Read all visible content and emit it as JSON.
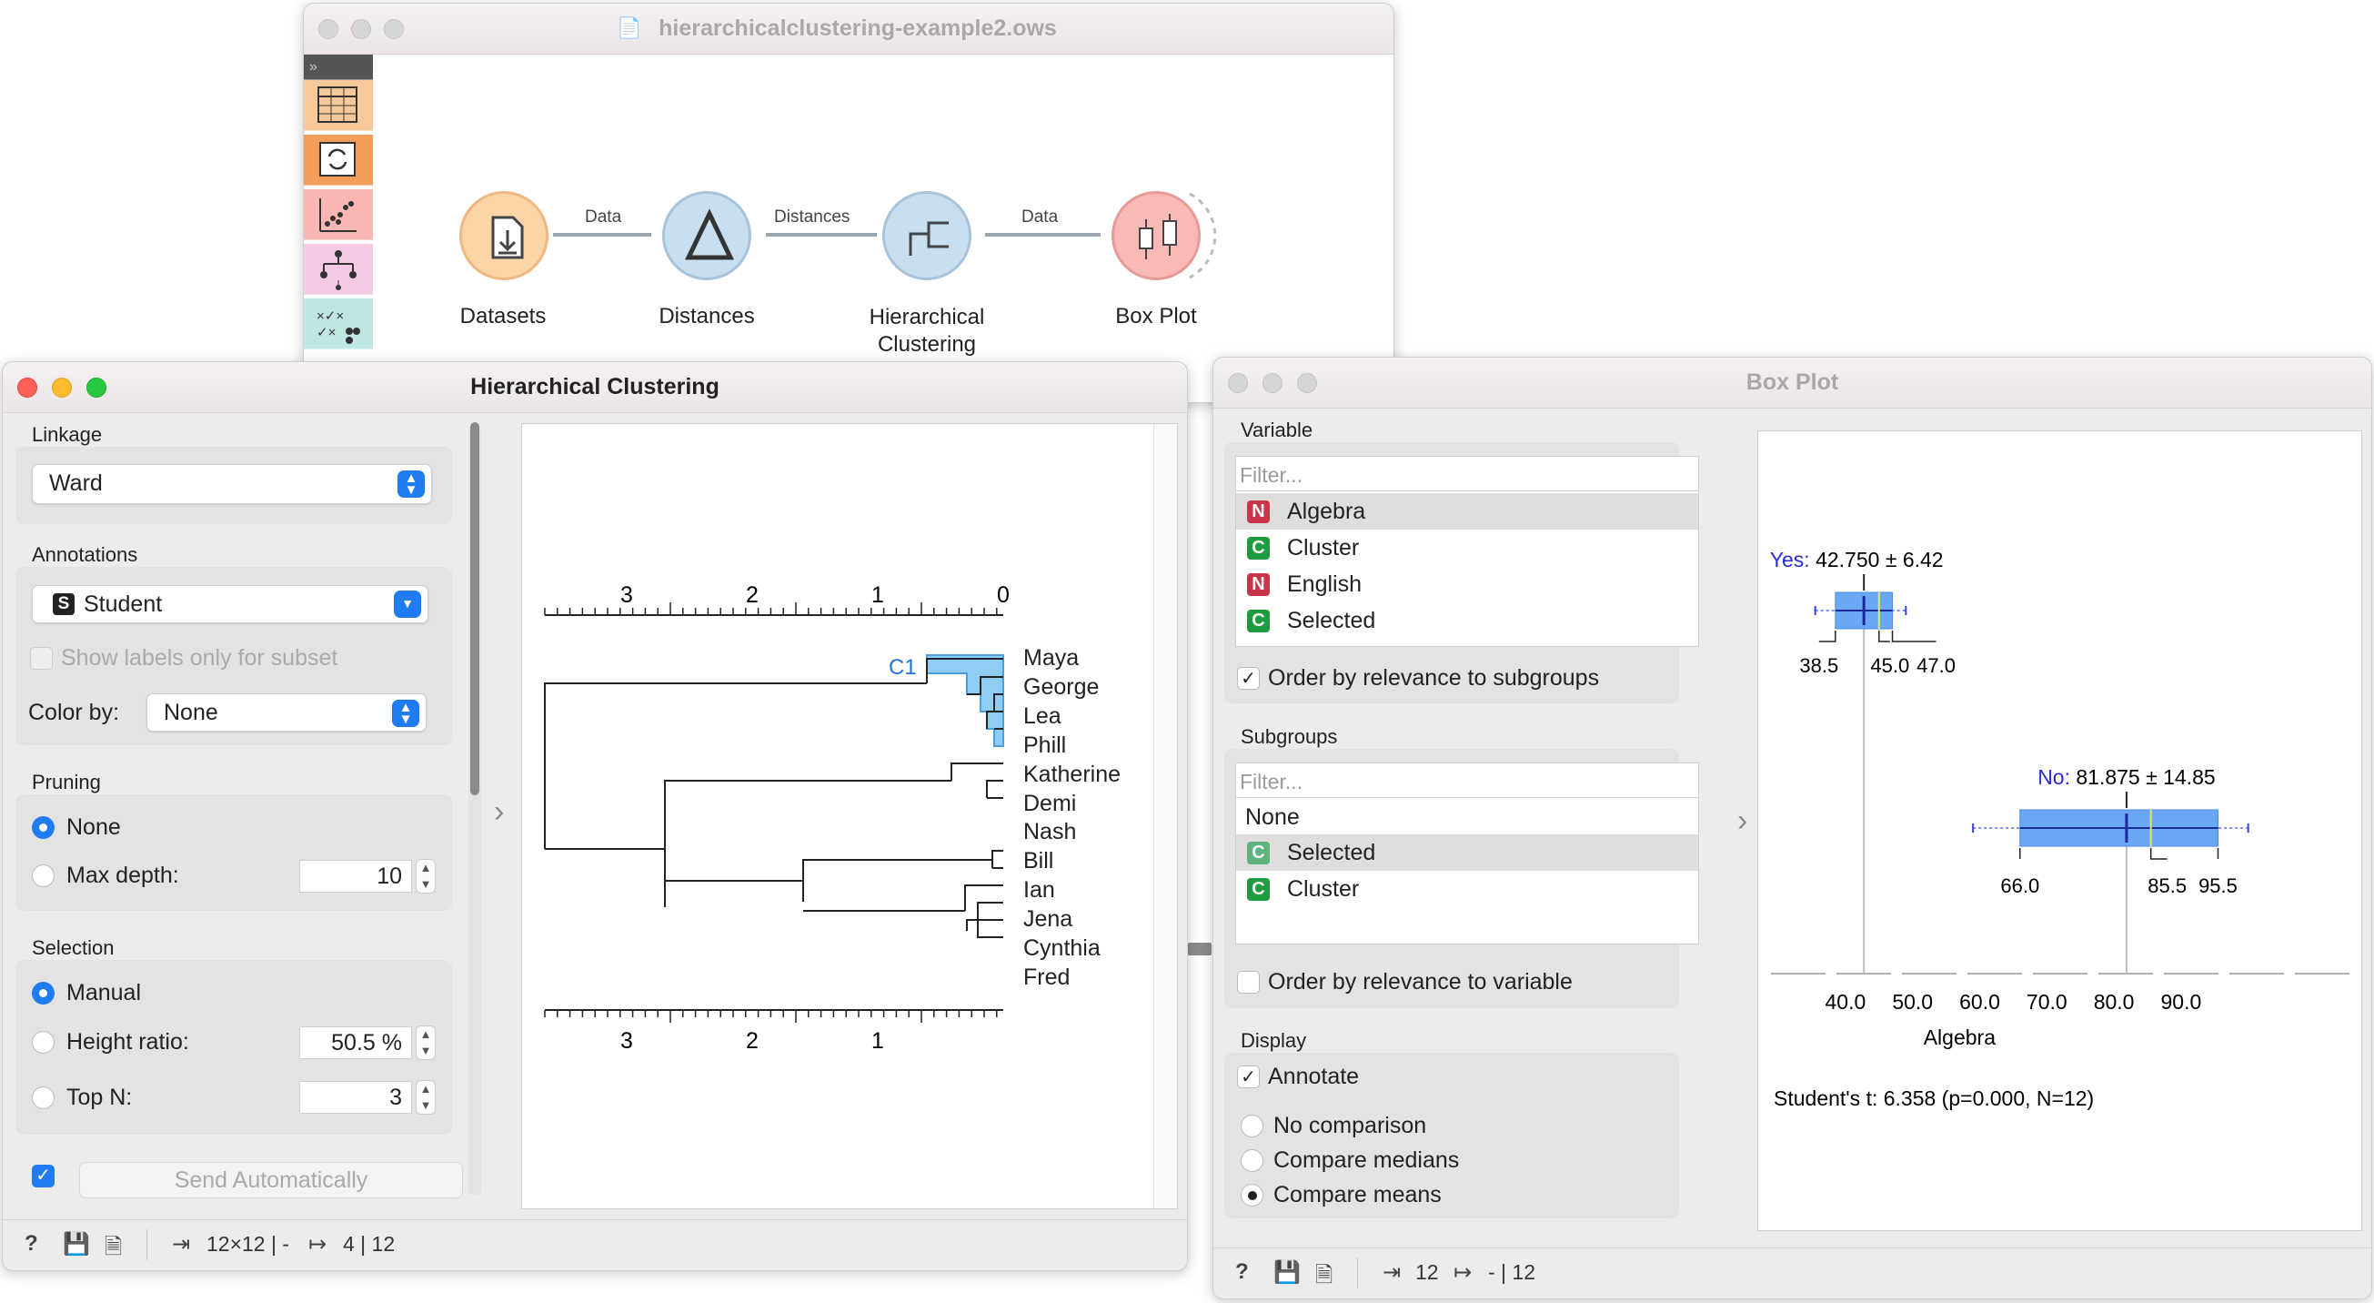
{
  "canvas_window": {
    "title": "hierarchicalclustering-example2.ows",
    "nodes": [
      {
        "label": "Datasets",
        "color": "#fbd5a8"
      },
      {
        "label": "Distances",
        "color": "#c8dff0"
      },
      {
        "label": "Hierarchical\nClustering",
        "color": "#c8dff0"
      },
      {
        "label": "Box Plot",
        "color": "#f9b9b6"
      }
    ],
    "links": [
      "Data",
      "Distances",
      "Data"
    ]
  },
  "hc": {
    "title": "Hierarchical Clustering",
    "linkage_label": "Linkage",
    "linkage_value": "Ward",
    "annotations_label": "Annotations",
    "annotation_value": "Student",
    "annotation_badge": "S",
    "show_labels_subset": "Show labels only for subset",
    "color_by_label": "Color by:",
    "color_by_value": "None",
    "pruning_label": "Pruning",
    "pruning_none": "None",
    "pruning_max_depth": "Max depth:",
    "max_depth_value": "10",
    "selection_label": "Selection",
    "selection_manual": "Manual",
    "selection_height": "Height ratio:",
    "height_value": "50.5 %",
    "selection_topn": "Top N:",
    "topn_value": "3",
    "send_auto": "Send Automatically",
    "status_in": "12×12 | -",
    "status_out": "4 | 12",
    "cluster_label": "C1",
    "top_axis": [
      "3",
      "2",
      "1",
      "0"
    ],
    "bottom_axis": [
      "3",
      "2",
      "1"
    ],
    "leaves": [
      "Maya",
      "George",
      "Lea",
      "Phill",
      "Katherine",
      "Demi",
      "Nash",
      "Bill",
      "Ian",
      "Jena",
      "Cynthia",
      "Fred"
    ]
  },
  "bp": {
    "title": "Box Plot",
    "variable_label": "Variable",
    "filter_placeholder": "Filter...",
    "variables": [
      {
        "badge": "N",
        "name": "Algebra"
      },
      {
        "badge": "C",
        "name": "Cluster"
      },
      {
        "badge": "N",
        "name": "English"
      },
      {
        "badge": "C",
        "name": "Selected"
      }
    ],
    "order_subgroups": "Order by relevance to subgroups",
    "subgroups_label": "Subgroups",
    "subgroups_none": "None",
    "subgroups": [
      {
        "badge": "C",
        "name": "Selected"
      },
      {
        "badge": "C",
        "name": "Cluster"
      }
    ],
    "order_variable": "Order by relevance to variable",
    "display_label": "Display",
    "annotate": "Annotate",
    "no_comparison": "No comparison",
    "compare_medians": "Compare medians",
    "compare_means": "Compare means",
    "status_in": "12",
    "status_out": "- | 12",
    "chart_data": {
      "type": "box",
      "xlabel": "Algebra",
      "x_ticks": [
        "40.0",
        "50.0",
        "60.0",
        "70.0",
        "80.0",
        "90.0"
      ],
      "groups": [
        {
          "name": "Yes",
          "label": "Yes:",
          "stats": "42.750 ± 6.42",
          "min": 35.5,
          "q1": 38.5,
          "median": 45.0,
          "mean": 42.75,
          "q3": 47.0,
          "max": 49.0,
          "annotations": [
            "38.5",
            "45.0",
            "47.0"
          ]
        },
        {
          "name": "No",
          "label": "No:",
          "stats": "81.875 ± 14.85",
          "min": 59.0,
          "q1": 66.0,
          "median": 85.5,
          "mean": 81.875,
          "q3": 95.5,
          "max": 100.0,
          "annotations": [
            "66.0",
            "85.5",
            "95.5"
          ]
        }
      ],
      "test": "Student's t: 6.358 (p=0.000, N=12)"
    }
  }
}
